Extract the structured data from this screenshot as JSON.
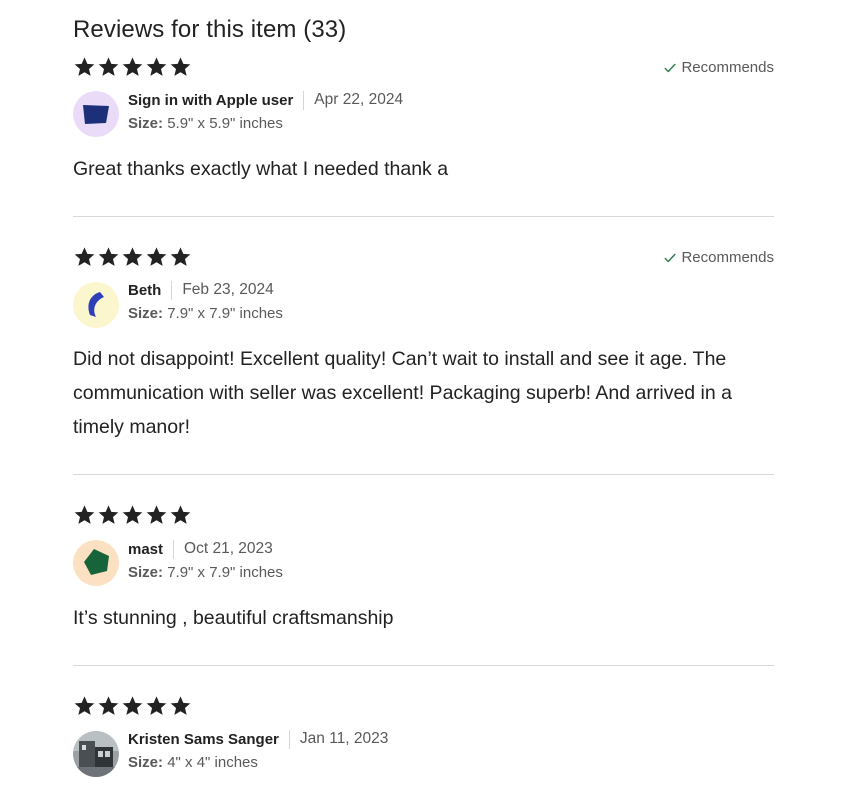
{
  "section": {
    "title": "Reviews for this item (33)"
  },
  "colors": {
    "star": "#222222",
    "check": "#2a7a4a",
    "text": "#222222",
    "muted": "#595959",
    "divider": "#d9d9d9"
  },
  "reviews": [
    {
      "rating": 5,
      "recommends": "Recommends",
      "reviewer": "Sign in with Apple user",
      "date": "Apr 22, 2024",
      "size_label": "Size:",
      "size_value": "5.9\" x 5.9\" inches",
      "text": "Great thanks exactly what I needed thank a",
      "avatar": {
        "icon": "navy-quadrilateral-avatar",
        "bg": "#eadcf8",
        "fg": "#1c2f78"
      }
    },
    {
      "rating": 5,
      "recommends": "Recommends",
      "reviewer": "Beth",
      "date": "Feb 23, 2024",
      "size_label": "Size:",
      "size_value": "7.9\" x 7.9\" inches",
      "text": "Did not disappoint! Excellent quality! Can’t wait to install and see it age. The communication with seller was excellent! Packaging superb! And arrived in a timely manor!",
      "avatar": {
        "icon": "blue-crescent-avatar",
        "bg": "#fbf6cd",
        "fg": "#2f3fb8"
      }
    },
    {
      "rating": 5,
      "reviewer": "mast",
      "date": "Oct 21, 2023",
      "size_label": "Size:",
      "size_value": "7.9\" x 7.9\" inches",
      "text": "It’s stunning , beautiful craftsmanship",
      "avatar": {
        "icon": "green-pentagon-avatar",
        "bg": "#fbe0c2",
        "fg": "#17643b"
      }
    },
    {
      "rating": 5,
      "reviewer": "Kristen Sams Sanger",
      "date": "Jan 11, 2023",
      "size_label": "Size:",
      "size_value": "4\" x 4\" inches",
      "avatar": {
        "icon": "user-photo-avatar",
        "bg": "#8a8f92",
        "fg": "#3a3f44"
      }
    }
  ]
}
